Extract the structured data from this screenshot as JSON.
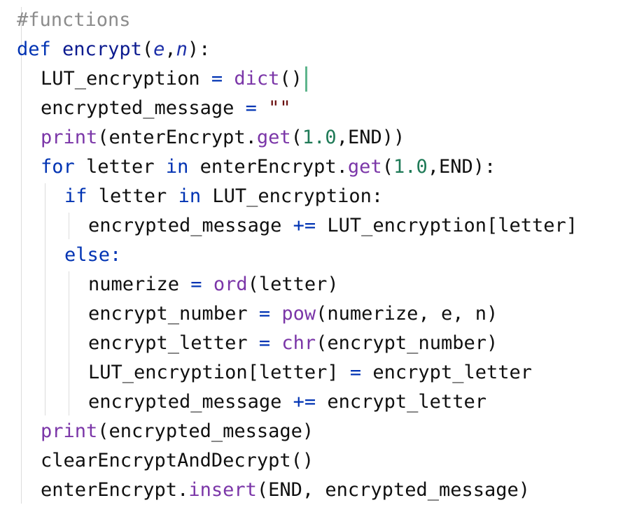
{
  "editor": {
    "lines": [
      {
        "indent": 0,
        "tokens": [
          {
            "t": "#functions",
            "c": "cm"
          }
        ]
      },
      {
        "indent": 0,
        "tokens": [
          {
            "t": "def",
            "c": "kw"
          },
          {
            "t": " ",
            "c": "tx"
          },
          {
            "t": "encrypt",
            "c": "fn"
          },
          {
            "t": "(",
            "c": "tx"
          },
          {
            "t": "e",
            "c": "param"
          },
          {
            "t": ",",
            "c": "tx"
          },
          {
            "t": "n",
            "c": "param"
          },
          {
            "t": "):",
            "c": "tx"
          }
        ]
      },
      {
        "indent": 1,
        "tokens": [
          {
            "t": "LUT_encryption",
            "c": "tx"
          },
          {
            "t": " = ",
            "c": "op"
          },
          {
            "t": "dict",
            "c": "bi"
          },
          {
            "t": "()",
            "c": "tx"
          }
        ]
      },
      {
        "indent": 1,
        "tokens": [
          {
            "t": "encrypted_message",
            "c": "tx"
          },
          {
            "t": " = ",
            "c": "op"
          },
          {
            "t": "\"\"",
            "c": "str"
          }
        ]
      },
      {
        "indent": 1,
        "tokens": [
          {
            "t": "print",
            "c": "bi"
          },
          {
            "t": "(enterEncrypt.",
            "c": "tx"
          },
          {
            "t": "get",
            "c": "bi"
          },
          {
            "t": "(",
            "c": "tx"
          },
          {
            "t": "1.0",
            "c": "num"
          },
          {
            "t": ",END))",
            "c": "tx"
          }
        ]
      },
      {
        "indent": 1,
        "tokens": [
          {
            "t": "for",
            "c": "kw"
          },
          {
            "t": " letter ",
            "c": "tx"
          },
          {
            "t": "in",
            "c": "kw"
          },
          {
            "t": " enterEncrypt.",
            "c": "tx"
          },
          {
            "t": "get",
            "c": "bi"
          },
          {
            "t": "(",
            "c": "tx"
          },
          {
            "t": "1.0",
            "c": "num"
          },
          {
            "t": ",END):",
            "c": "tx"
          }
        ]
      },
      {
        "indent": 2,
        "tokens": [
          {
            "t": "if",
            "c": "kw"
          },
          {
            "t": " letter ",
            "c": "tx"
          },
          {
            "t": "in",
            "c": "kw"
          },
          {
            "t": " LUT_encryption:",
            "c": "tx"
          }
        ]
      },
      {
        "indent": 3,
        "tokens": [
          {
            "t": "encrypted_message ",
            "c": "tx"
          },
          {
            "t": "+=",
            "c": "op"
          },
          {
            "t": " LUT_encryption[letter]",
            "c": "tx"
          }
        ]
      },
      {
        "indent": 2,
        "tokens": [
          {
            "t": "else:",
            "c": "kw"
          }
        ]
      },
      {
        "indent": 3,
        "tokens": [
          {
            "t": "numerize",
            "c": "tx"
          },
          {
            "t": " = ",
            "c": "op"
          },
          {
            "t": "ord",
            "c": "bi"
          },
          {
            "t": "(letter)",
            "c": "tx"
          }
        ]
      },
      {
        "indent": 3,
        "tokens": [
          {
            "t": "encrypt_number",
            "c": "tx"
          },
          {
            "t": " = ",
            "c": "op"
          },
          {
            "t": "pow",
            "c": "bi"
          },
          {
            "t": "(numerize, e, n)",
            "c": "tx"
          }
        ]
      },
      {
        "indent": 3,
        "tokens": [
          {
            "t": "encrypt_letter",
            "c": "tx"
          },
          {
            "t": " = ",
            "c": "op"
          },
          {
            "t": "chr",
            "c": "bi"
          },
          {
            "t": "(encrypt_number)",
            "c": "tx"
          }
        ]
      },
      {
        "indent": 3,
        "tokens": [
          {
            "t": "LUT_encryption[letter]",
            "c": "tx"
          },
          {
            "t": " = ",
            "c": "op"
          },
          {
            "t": "encrypt_letter",
            "c": "tx"
          }
        ]
      },
      {
        "indent": 3,
        "tokens": [
          {
            "t": "encrypted_message ",
            "c": "tx"
          },
          {
            "t": "+=",
            "c": "op"
          },
          {
            "t": " encrypt_letter",
            "c": "tx"
          }
        ]
      },
      {
        "indent": 1,
        "tokens": [
          {
            "t": "print",
            "c": "bi"
          },
          {
            "t": "(encrypted_message)",
            "c": "tx"
          }
        ]
      },
      {
        "indent": 1,
        "tokens": [
          {
            "t": "clearEncryptAndDecrypt()",
            "c": "tx"
          }
        ]
      },
      {
        "indent": 1,
        "tokens": [
          {
            "t": "enterEncrypt.",
            "c": "tx"
          },
          {
            "t": "insert",
            "c": "bi"
          },
          {
            "t": "(END, encrypted_message)",
            "c": "tx"
          }
        ]
      }
    ],
    "caret_line": 2
  },
  "colors": {
    "keyword": "#0033b3",
    "builtin": "#7b36a8",
    "number": "#1f7a57",
    "string": "#6a0f0f",
    "comment": "#8c8c8c",
    "text": "#101010",
    "caret": "#5fb58d",
    "indent_guide": "#dcdcdc"
  }
}
